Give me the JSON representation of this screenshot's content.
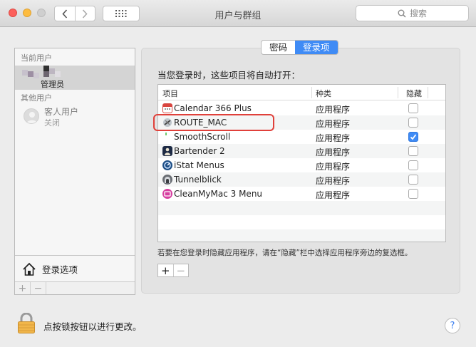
{
  "window": {
    "title": "用户与群组",
    "search_placeholder": "搜索"
  },
  "sidebar": {
    "current_users_label": "当前用户",
    "current_user": {
      "role": "管理员"
    },
    "other_users_label": "其他用户",
    "guest": {
      "name": "客人用户",
      "status": "关闭"
    },
    "login_options_label": "登录选项",
    "add_label": "+",
    "remove_label": "−"
  },
  "tabs": [
    {
      "label": "密码",
      "active": false
    },
    {
      "label": "登录项",
      "active": true
    }
  ],
  "main": {
    "heading": "当您登录时，这些项目将自动打开：",
    "columns": {
      "item": "项目",
      "kind": "种类",
      "hide": "隐藏"
    },
    "rows": [
      {
        "name": "Calendar 366 Plus",
        "kind": "应用程序",
        "hidden": false,
        "icon": "calendar-icon",
        "highlighted": false
      },
      {
        "name": "ROUTE_MAC",
        "kind": "应用程序",
        "hidden": false,
        "icon": "route-mac-icon",
        "highlighted": true
      },
      {
        "name": "SmoothScroll",
        "kind": "应用程序",
        "hidden": true,
        "icon": "smoothscroll-icon",
        "highlighted": false
      },
      {
        "name": "Bartender 2",
        "kind": "应用程序",
        "hidden": false,
        "icon": "bartender-icon",
        "highlighted": false
      },
      {
        "name": "iStat Menus",
        "kind": "应用程序",
        "hidden": false,
        "icon": "istat-icon",
        "highlighted": false
      },
      {
        "name": "Tunnelblick",
        "kind": "应用程序",
        "hidden": false,
        "icon": "tunnelblick-icon",
        "highlighted": false
      },
      {
        "name": "CleanMyMac 3 Menu",
        "kind": "应用程序",
        "hidden": false,
        "icon": "cleanmymac-icon",
        "highlighted": false
      }
    ],
    "hint": "若要在您登录时隐藏应用程序，请在“隐藏”栏中选择应用程序旁边的复选框。",
    "add_label": "+",
    "remove_label": "−"
  },
  "footer": {
    "lock_text": "点按锁按钮以进行更改。",
    "help_label": "?"
  },
  "colors": {
    "accent": "#3f8bf5",
    "highlight_box": "#e0403a",
    "close": "#fc605b",
    "minimize": "#fdbc40"
  }
}
